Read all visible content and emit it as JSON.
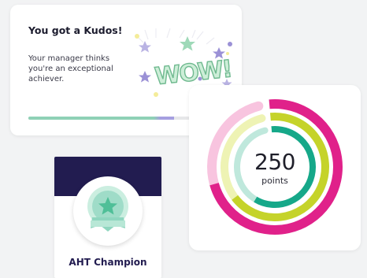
{
  "kudos": {
    "title": "You got a Kudos!",
    "message": "Your manager thinks you're an exceptional achiever.",
    "art_text": "WOW!",
    "progress": 0.86,
    "colors": {
      "green": "#8fd1b6",
      "purple": "#a59fe0",
      "star_green": "#9ed9b8",
      "star_purple": "#9b91d6",
      "dot_yellow": "#f4ec9a"
    }
  },
  "badge": {
    "label": "AHT Champion",
    "icon": "star-medal-icon",
    "colors": {
      "band": "#221c50",
      "medal": "#8fd6bf",
      "medal_dark": "#4fbf98"
    }
  },
  "points": {
    "value": "250",
    "label": "points",
    "rings": [
      {
        "name": "outer",
        "color": "#e0218a",
        "fill": 0.72
      },
      {
        "name": "middle",
        "color": "#c5d32a",
        "fill": 0.66
      },
      {
        "name": "inner",
        "color": "#16a889",
        "fill": 0.6
      }
    ]
  }
}
